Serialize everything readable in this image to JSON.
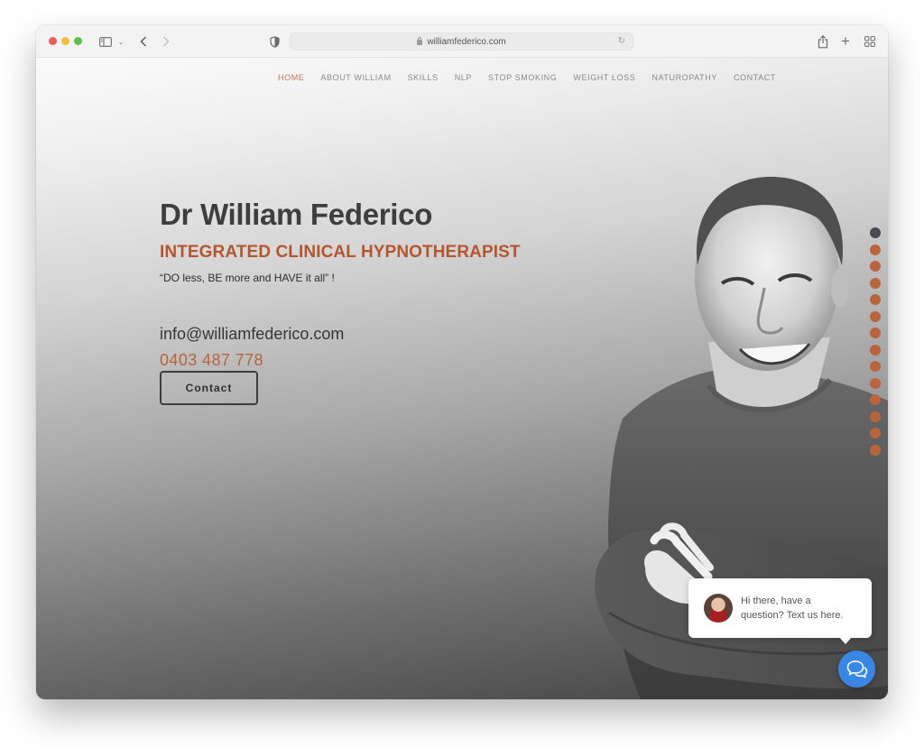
{
  "browser": {
    "url": "williamfederico.com",
    "icons": {
      "sidebar": "sidebar-icon",
      "back": "chevron-left-icon",
      "forward": "chevron-right-icon",
      "privacy": "shield-icon",
      "lock": "lock-icon",
      "reload": "reload-icon",
      "share": "share-icon",
      "new_tab": "plus-icon",
      "tab_overview": "grid-icon"
    },
    "back_glyph": "‹",
    "forward_glyph": "›",
    "new_tab_glyph": "+",
    "reload_glyph": "↻",
    "chevron_glyph": "⌄"
  },
  "nav": {
    "items": [
      {
        "label": "HOME",
        "active": true
      },
      {
        "label": "ABOUT WILLIAM",
        "active": false
      },
      {
        "label": "SKILLS",
        "active": false
      },
      {
        "label": "NLP",
        "active": false
      },
      {
        "label": "STOP SMOKING",
        "active": false
      },
      {
        "label": "WEIGHT LOSS",
        "active": false
      },
      {
        "label": "NATUROPATHY",
        "active": false
      },
      {
        "label": "CONTACT",
        "active": false
      }
    ]
  },
  "hero": {
    "name": "Dr William Federico",
    "subtitle": "INTEGRATED CLINICAL HYPNOTHERAPIST",
    "quote": "“DO less, BE more and HAVE it all” !",
    "email": "info@williamfederico.com",
    "phone": "0403 487 778",
    "cta_label": "Contact"
  },
  "dot_nav": {
    "count": 14,
    "active_index": 0
  },
  "chat": {
    "message_line1": "Hi there, have a",
    "message_line2": "question? Text us here.",
    "fab_icon": "chat-bubbles-icon"
  },
  "colors": {
    "accent": "#b8643a",
    "nav_active": "#c4764d",
    "dot_active": "#4a4a52",
    "chat_blue": "#3a86e4"
  }
}
